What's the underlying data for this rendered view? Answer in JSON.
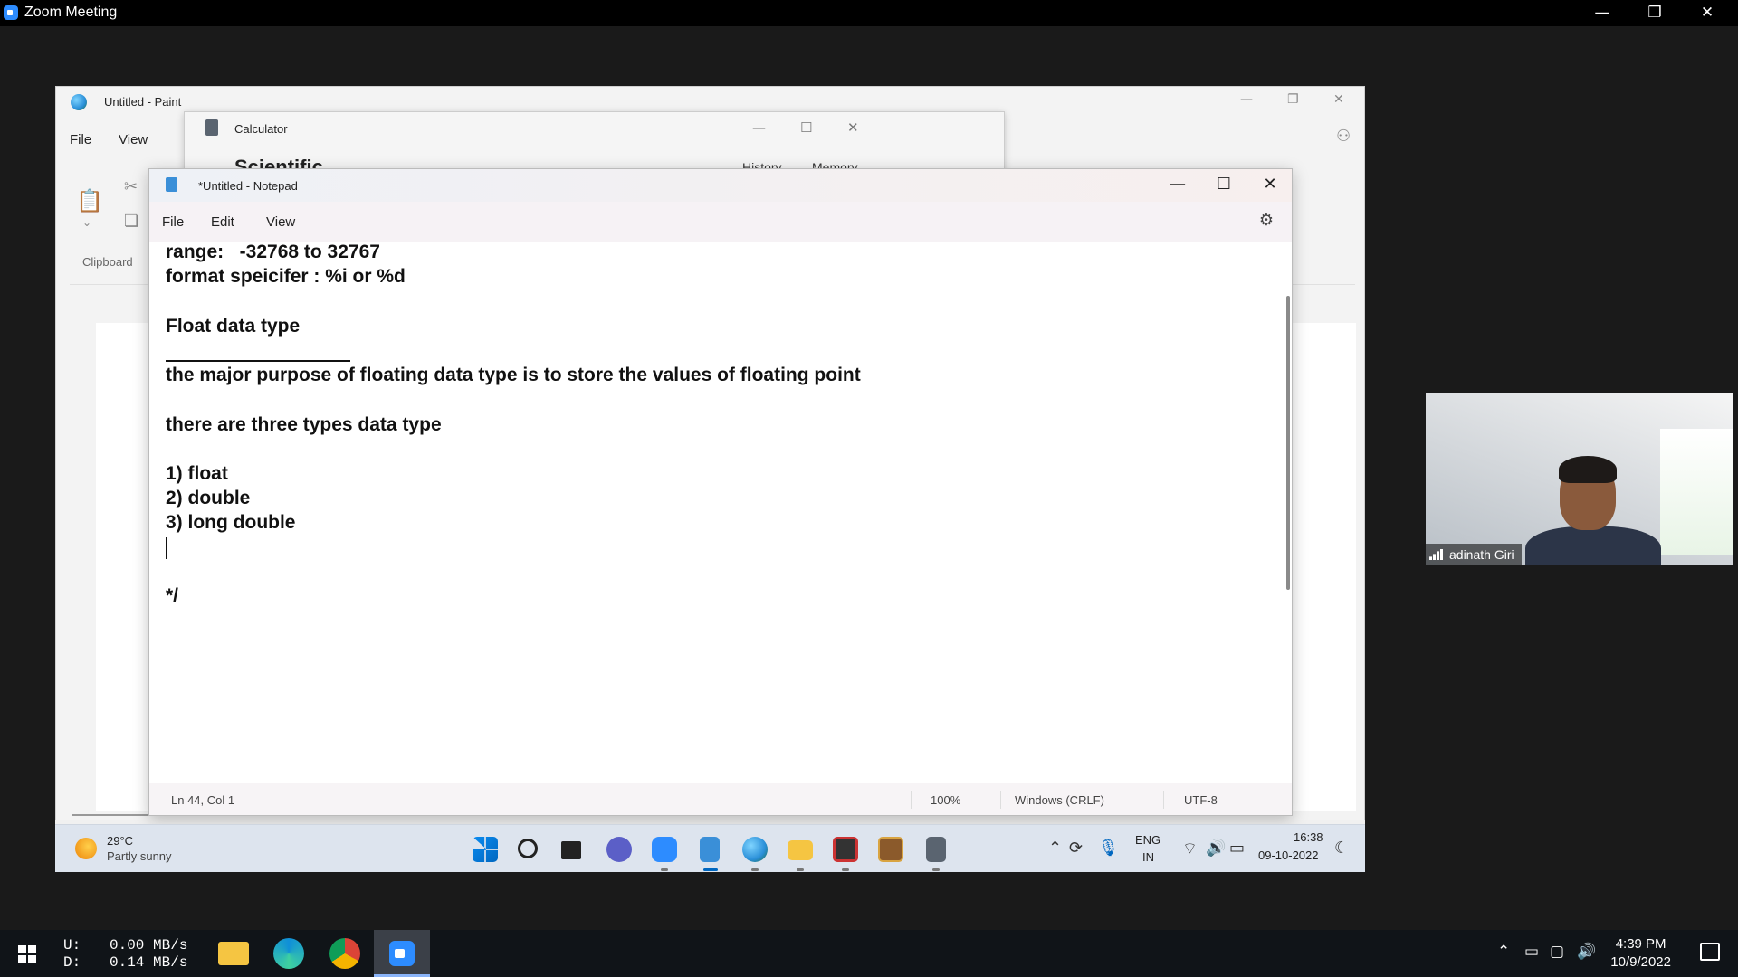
{
  "zoom": {
    "title": "Zoom Meeting"
  },
  "paint": {
    "title": "Untitled - Paint",
    "menu": [
      "File",
      "View"
    ],
    "clipboard_label": "Clipboard"
  },
  "calculator": {
    "title": "Calculator",
    "mode": "Scientific",
    "history": "History",
    "memory": "Memory"
  },
  "notepad": {
    "title": "*Untitled - Notepad",
    "menu": [
      "File",
      "Edit",
      "View"
    ],
    "lines": [
      "range:   -32768 to 32767",
      "format speicifer : %i or %d",
      "",
      "Float data type",
      "",
      "the major purpose of floating data type is to store the values of floating point",
      "",
      "there are three types data type",
      "",
      "1) float",
      "2) double",
      "3) long double",
      "",
      "",
      "*/"
    ],
    "status": {
      "position": "Ln 44, Col 1",
      "zoom": "100%",
      "line_ending": "Windows (CRLF)",
      "encoding": "UTF-8"
    }
  },
  "remote_taskbar": {
    "weather_temp": "29°C",
    "weather_desc": "Partly sunny",
    "lang_top": "ENG",
    "lang_bottom": "IN",
    "time": "16:38",
    "date": "09-10-2022",
    "apps": [
      "start",
      "search",
      "task-view",
      "teams-chat",
      "zoom",
      "notepad",
      "paint",
      "file-explorer",
      "media-player",
      "winrar",
      "calculator"
    ]
  },
  "video": {
    "participant": "adinath Giri"
  },
  "local_taskbar": {
    "upload_label": "U:",
    "upload_value": "0.00 MB/s",
    "download_label": "D:",
    "download_value": "0.14 MB/s",
    "time": "4:39 PM",
    "date": "10/9/2022"
  },
  "colors": {
    "zoom_blue": "#2d8cff",
    "remote_taskbar": "#dde4ee",
    "local_taskbar": "#101418"
  }
}
